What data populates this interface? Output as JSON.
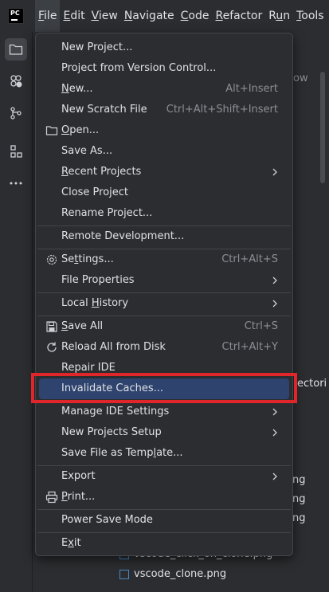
{
  "menubar": {
    "logo": "PC",
    "items": [
      {
        "pre": "",
        "u": "F",
        "post": "ile"
      },
      {
        "pre": "",
        "u": "E",
        "post": "dit"
      },
      {
        "pre": "",
        "u": "V",
        "post": "iew"
      },
      {
        "pre": "",
        "u": "N",
        "post": "avigate"
      },
      {
        "pre": "",
        "u": "C",
        "post": "ode"
      },
      {
        "pre": "",
        "u": "R",
        "post": "efactor"
      },
      {
        "pre": "R",
        "u": "u",
        "post": "n"
      },
      {
        "pre": "",
        "u": "T",
        "post": "ools"
      }
    ]
  },
  "toolbar_icons": [
    "folder-icon",
    "plugins-icon",
    "vcs-icon",
    "structure-icon",
    "more-icon"
  ],
  "background": {
    "text_ow": "ow",
    "text_ectori": "ectori",
    "text_ng1": "ng",
    "text_ng2": "ng",
    "text_ng3": "ng",
    "file1": "vscode_click_on_clone.png",
    "file2": "vscode_clone.png"
  },
  "file_menu": {
    "new_project": "New Project...",
    "project_from_vcs": "Project from Version Control...",
    "new": {
      "pre": "",
      "u": "N",
      "post": "ew...",
      "shortcut": "Alt+Insert"
    },
    "new_scratch": {
      "label": "New Scratch File",
      "shortcut": "Ctrl+Alt+Shift+Insert"
    },
    "open": {
      "pre": "",
      "u": "O",
      "post": "pen..."
    },
    "save_as": "Save As...",
    "recent_projects": {
      "pre": "",
      "u": "R",
      "post": "ecent Projects"
    },
    "close_project": "Close Project",
    "rename_project": "Rename Project...",
    "remote_dev": "Remote Development...",
    "settings": {
      "pre": "Se",
      "u": "t",
      "post": "tings...",
      "shortcut": "Ctrl+Alt+S"
    },
    "file_properties": "File Properties",
    "local_history": {
      "pre": "Local ",
      "u": "H",
      "post": "istory"
    },
    "save_all": {
      "pre": "",
      "u": "S",
      "post": "ave All",
      "shortcut": "Ctrl+S"
    },
    "reload_all": {
      "label": "Reload All from Disk",
      "shortcut": "Ctrl+Alt+Y"
    },
    "repair_ide": "Repair IDE",
    "invalidate_caches": "Invalidate Caches...",
    "manage_ide_settings": "Manage IDE Settings",
    "new_projects_setup": "New Projects Setup",
    "save_as_template": {
      "pre": "Save File as Temp",
      "u": "l",
      "post": "ate..."
    },
    "export": "Export",
    "print": {
      "pre": "",
      "u": "P",
      "post": "rint..."
    },
    "power_save_mode": "Power Save Mode",
    "exit": {
      "pre": "E",
      "u": "x",
      "post": "it"
    }
  },
  "colors": {
    "highlight": "#2e436e",
    "annotation_border": "#e0262b",
    "background": "#2b2d30"
  }
}
